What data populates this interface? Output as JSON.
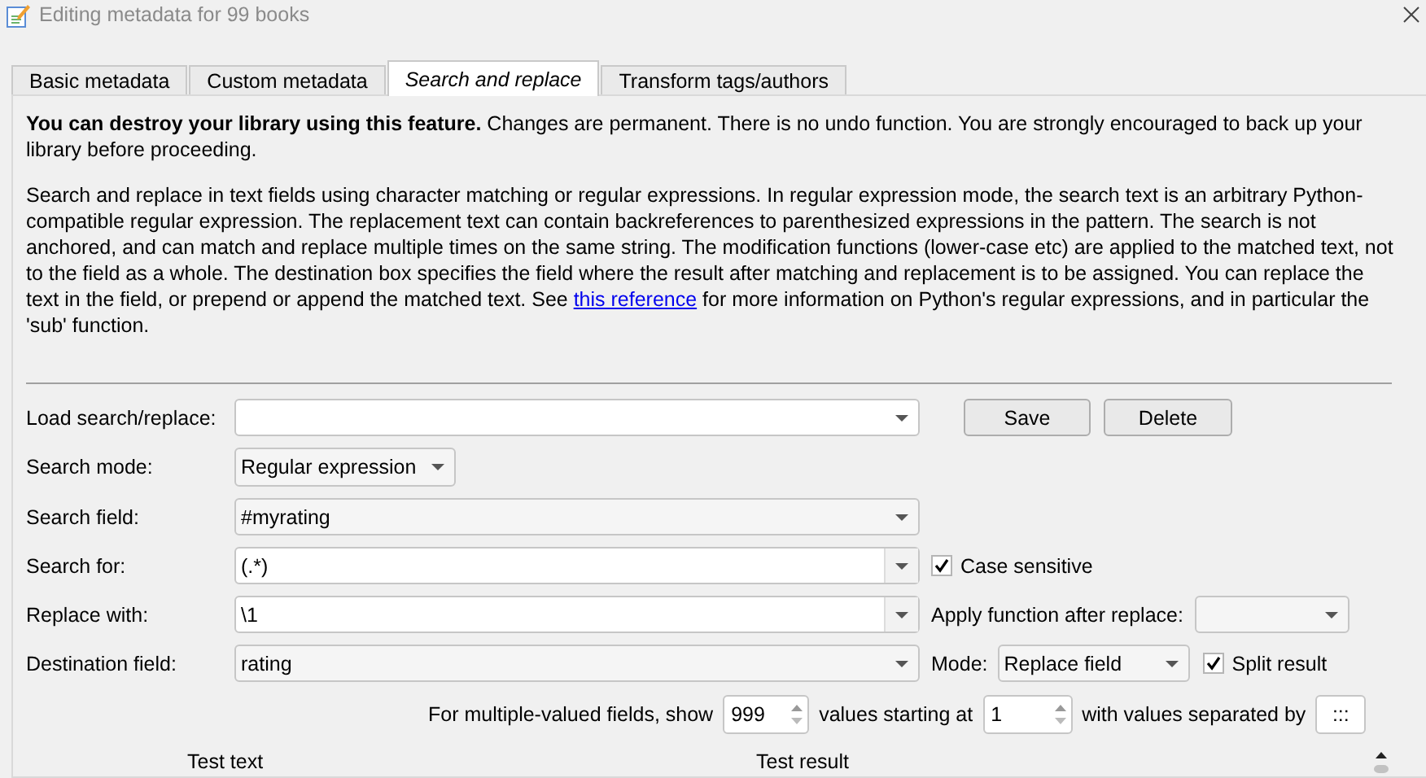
{
  "window": {
    "title": "Editing metadata for 99 books"
  },
  "tabs": [
    {
      "label": "Basic metadata",
      "selected": false
    },
    {
      "label": "Custom metadata",
      "selected": false
    },
    {
      "label": "Search and replace",
      "selected": true
    },
    {
      "label": "Transform tags/authors",
      "selected": false
    }
  ],
  "warning": "**You can destroy your library using this feature.** Changes are permanent. There is no undo function. You are strongly encouraged to back up your library before proceeding.",
  "description": {
    "text": "Search and replace in text fields using character matching or regular expressions. In regular expression mode, the search text is an arbitrary Python-compatible regular expression. The replacement text can contain backreferences to parenthesized expressions in the pattern. The search is not anchored, and can match and replace multiple times on the same string. The modification functions (lower-case etc) are applied to the matched text, not to the field as a whole. The destination box specifies the field where the result after matching and replacement is to be assigned. You can replace the text in the field, or prepend or append the matched text. See",
    "link": "this reference",
    "text_after": "for more information on Python's regular expressions, and in particular the 'sub' function."
  },
  "load": {
    "label": "Load search/replace:",
    "buttons": [
      "Save",
      "Delete"
    ]
  },
  "search_mode": {
    "label": "Search mode:",
    "value": "Regular expression"
  },
  "search_field": {
    "label": "Search field:",
    "value": "#myrating"
  },
  "search_for": {
    "label": "Search for:",
    "value": "(.*)",
    "case_sensitive": {
      "label": "Case sensitive",
      "checked": true
    }
  },
  "replace_with": {
    "label": "Replace with:",
    "value": "\\1",
    "apply_function": {
      "label": "Apply function after replace:"
    }
  },
  "destination": {
    "label": "Destination field:",
    "value": "rating",
    "mode": {
      "label": "Mode:",
      "value": "Replace field"
    },
    "split_result": {
      "label": "Split result",
      "checked": true
    }
  },
  "multiple": {
    "show_label": "For multiple-valued fields, show",
    "show": "999",
    "start_label": "values starting at",
    "start": "1",
    "separator_label": "with values separated by",
    "separator": ":::"
  },
  "test": {
    "columns": [
      "Test text",
      "Test result"
    ]
  }
}
